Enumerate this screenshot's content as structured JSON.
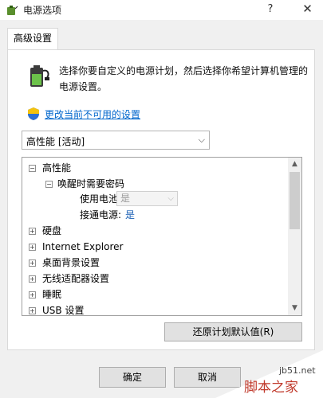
{
  "window": {
    "title": "电源选项",
    "help_glyph": "?",
    "close_glyph": "✕"
  },
  "tabs": [
    {
      "label": "高级设置"
    }
  ],
  "intro": {
    "description": "选择你要自定义的电源计划，然后选择你希望计算机管理的电源设置。",
    "icon": "battery-plug-icon"
  },
  "link": {
    "label": "更改当前不可用的设置",
    "icon": "uac-shield-icon"
  },
  "plan_selector": {
    "value": "高性能 [活动]"
  },
  "tree": {
    "items": [
      {
        "toggle": "⊟",
        "label": "高性能"
      },
      {
        "toggle": "⊟",
        "label": "唤醒时需要密码"
      },
      {
        "label": "使用电池:",
        "value": "是"
      },
      {
        "label": "接通电源:",
        "value": "是"
      },
      {
        "toggle": "⊞",
        "label": "硬盘"
      },
      {
        "toggle": "⊞",
        "label": "Internet Explorer"
      },
      {
        "toggle": "⊞",
        "label": "桌面背景设置"
      },
      {
        "toggle": "⊞",
        "label": "无线适配器设置"
      },
      {
        "toggle": "⊞",
        "label": "睡眠"
      },
      {
        "toggle": "⊞",
        "label": "USB 设置"
      }
    ]
  },
  "buttons": {
    "restore": "还原计划默认值(R)",
    "ok": "确定",
    "cancel": "取消"
  },
  "watermark": {
    "url": "jb51.net",
    "text": "脚本之家"
  },
  "colors": {
    "link": "#0066cc",
    "value_blue": "#1a5fb4",
    "watermark": "#c0392b"
  }
}
